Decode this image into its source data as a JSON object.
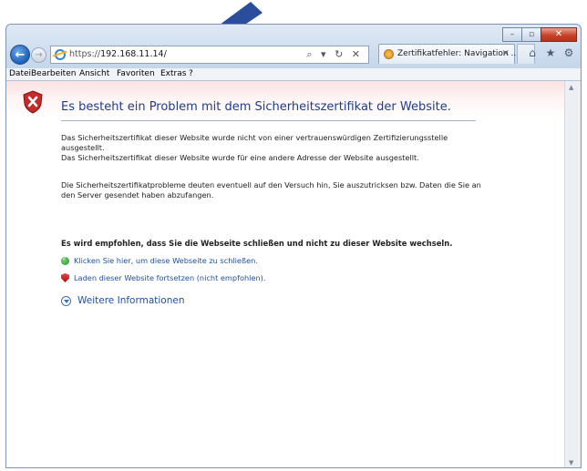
{
  "browser": {
    "url_prefix": "https://",
    "url_host": "192.168.11.14/",
    "address_tools": "⌕ ▾ ↻ ✕",
    "tab_label": "Zertifikatfehler: Navigation ...",
    "tab_close": "×",
    "back_glyph": "←",
    "forward_glyph": "→",
    "menu": [
      "Datei",
      "Bearbeiten",
      "Ansicht",
      "Favoriten",
      "Extras",
      "?"
    ],
    "caption": {
      "minimize": "–",
      "maximize": "▫",
      "close": "✕"
    },
    "tool_icons": {
      "home": "⌂",
      "favorites": "★",
      "settings": "⚙"
    }
  },
  "page": {
    "heading": "Es besteht ein Problem mit dem Sicherheitszertifikat der Website.",
    "para1_line1": "Das Sicherheitszertifikat dieser Website wurde nicht von einer vertrauenswürdigen Zertifizierungsstelle ausgestellt.",
    "para1_line2": "Das Sicherheitszertifikat dieser Website wurde für eine andere Adresse der Website ausgestellt.",
    "para2": "Die Sicherheitszertifikatprobleme deuten eventuell auf den Versuch hin, Sie auszutricksen bzw. Daten die Sie an den Server gesendet haben abzufangen.",
    "recommendation": "Es wird empfohlen, dass Sie die Webseite schließen und nicht zu dieser Website wechseln.",
    "link_close": "Klicken Sie hier, um diese Webseite zu schließen.",
    "link_continue": "Laden dieser Website fortsetzen (nicht empfohlen).",
    "more_info": "Weitere Informationen"
  },
  "colors": {
    "heading": "#1f3d8a",
    "link": "#1e4f9e",
    "annotation_arrow": "#2b4e9c"
  }
}
